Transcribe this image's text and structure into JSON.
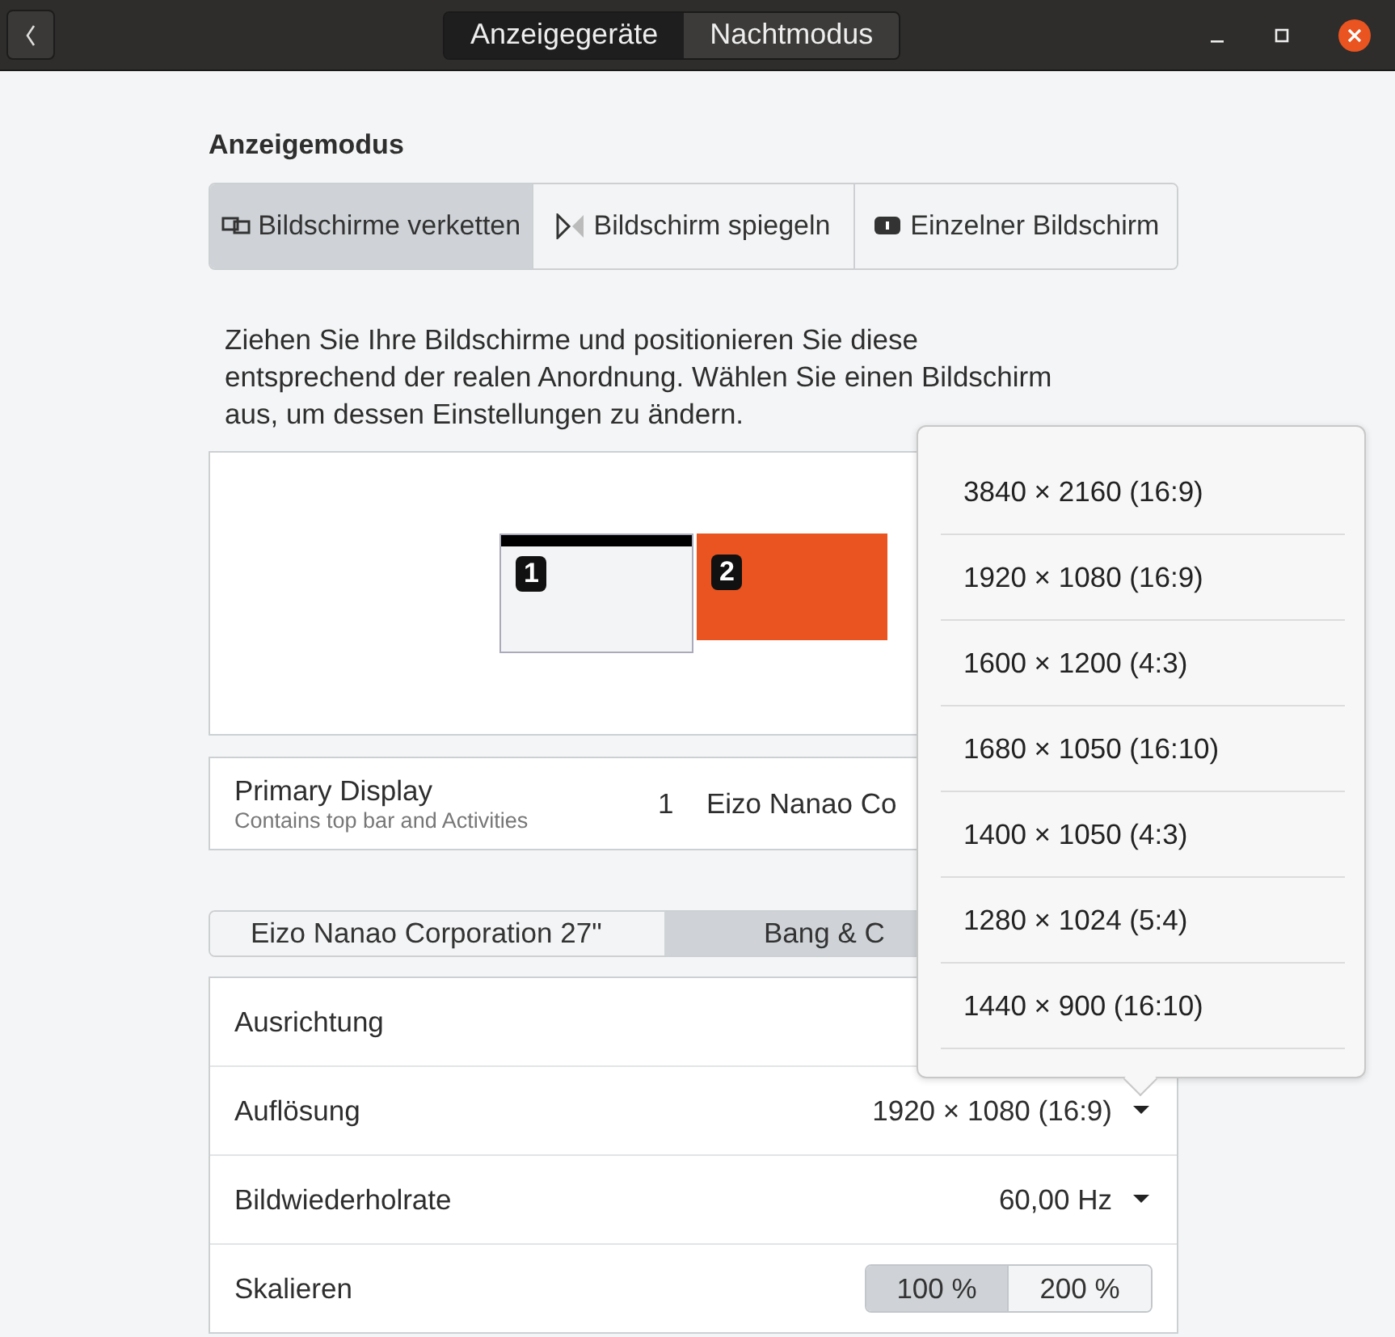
{
  "window": {
    "tabs": [
      {
        "label": "Anzeigegeräte",
        "selected": true
      },
      {
        "label": "Nachtmodus",
        "selected": false
      }
    ]
  },
  "display_mode": {
    "title": "Anzeigemodus",
    "options": [
      {
        "label": "Bildschirme verketten",
        "kind": "join",
        "selected": true
      },
      {
        "label": "Bildschirm spiegeln",
        "kind": "mirror",
        "selected": false
      },
      {
        "label": "Einzelner Bildschirm",
        "kind": "single",
        "selected": false
      }
    ]
  },
  "description": "Ziehen Sie Ihre Bildschirme und positionieren Sie diese\nentsprechend der realen Anordnung. Wählen Sie einen Bildschirm\naus, um dessen Einstellungen zu ändern.",
  "arrangement": {
    "monitors": [
      {
        "number": "1",
        "primary": true,
        "selected": false
      },
      {
        "number": "2",
        "primary": false,
        "selected": true
      }
    ]
  },
  "primary_display": {
    "label": "Primary Display",
    "hint": "Contains top bar and Activities",
    "number": "1",
    "value": "Eizo Nanao Co"
  },
  "display_tabs": [
    {
      "label": "Eizo Nanao Corporation 27\"",
      "selected": false
    },
    {
      "label": "Bang & C",
      "selected": true
    }
  ],
  "settings": [
    {
      "kind": "plain",
      "label": "Ausrichtung"
    },
    {
      "kind": "dropdown",
      "label": "Auflösung",
      "value": "1920 × 1080 (16:9)"
    },
    {
      "kind": "dropdown",
      "label": "Bildwiederholrate",
      "value": "60,00 Hz"
    },
    {
      "kind": "segmented",
      "label": "Skalieren",
      "options": [
        {
          "label": "100 %",
          "selected": true
        },
        {
          "label": "200 %",
          "selected": false
        }
      ]
    }
  ],
  "resolution_menu": {
    "items": [
      "3840 × 2160 (16:9)",
      "1920 × 1080 (16:9)",
      "1600 × 1200 (4:3)",
      "1680 × 1050 (16:10)",
      "1400 × 1050 (4:3)",
      "1280 × 1024 (5:4)",
      "1440 × 900 (16:10)"
    ]
  }
}
